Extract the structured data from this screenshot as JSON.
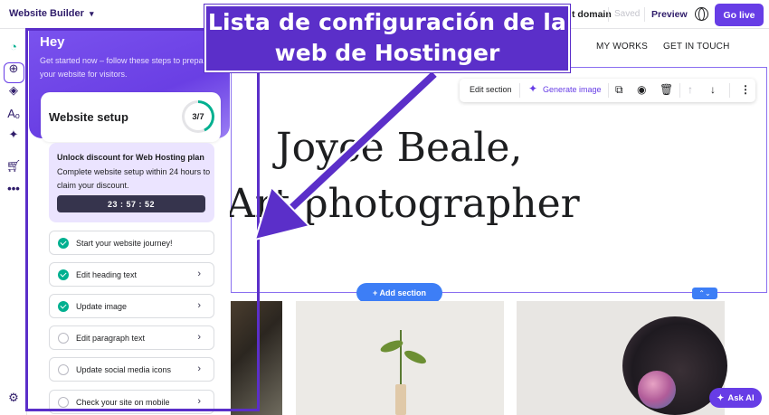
{
  "topbar": {
    "brand": "Website Builder",
    "domain": "t domain",
    "saved": "Saved",
    "preview": "Preview",
    "go_live": "Go live"
  },
  "site_nav": {
    "works": "MY WORKS",
    "contact": "GET IN TOUCH"
  },
  "edit_toolbar": {
    "edit_section": "Edit section",
    "generate_image": "Generate image"
  },
  "hero": {
    "line1": "Joyce Beale,",
    "line2": "Art photographer"
  },
  "add_section": "+ Add section",
  "ask_ai": "Ask AI",
  "setup_panel": {
    "greeting": "Hey",
    "intro": "Get started now – follow these steps to prepare your website for visitors.",
    "card_title": "Website setup",
    "progress": "3/7",
    "progress_fraction": 0.43,
    "promo_title": "Unlock discount for Web Hosting plan",
    "promo_text": "Complete website setup within 24 hours to claim your discount.",
    "timer": "23 : 57 : 52",
    "steps": [
      {
        "label": "Start your website journey!",
        "done": true
      },
      {
        "label": "Edit heading text",
        "done": true
      },
      {
        "label": "Update image",
        "done": true
      },
      {
        "label": "Edit paragraph text",
        "done": false
      },
      {
        "label": "Update social media icons",
        "done": false
      },
      {
        "label": "Check your site on mobile",
        "done": false
      }
    ]
  },
  "annotation": {
    "line1": "Lista de configuración de la",
    "line2": "web de Hostinger",
    "color": "#5b2fc9"
  },
  "colors": {
    "accent": "#673de6",
    "success": "#00b090",
    "selection": "#3d7ef6"
  },
  "icons": [
    "chevron-down-icon",
    "globe-icon",
    "setup-icon",
    "add-icon",
    "layers-icon",
    "typography-icon",
    "ai-sparkle-icon",
    "cart-icon",
    "more-icon",
    "help-icon",
    "duplicate-icon",
    "eye-icon",
    "trash-icon",
    "arrow-up-icon",
    "arrow-down-icon",
    "kebab-icon"
  ]
}
